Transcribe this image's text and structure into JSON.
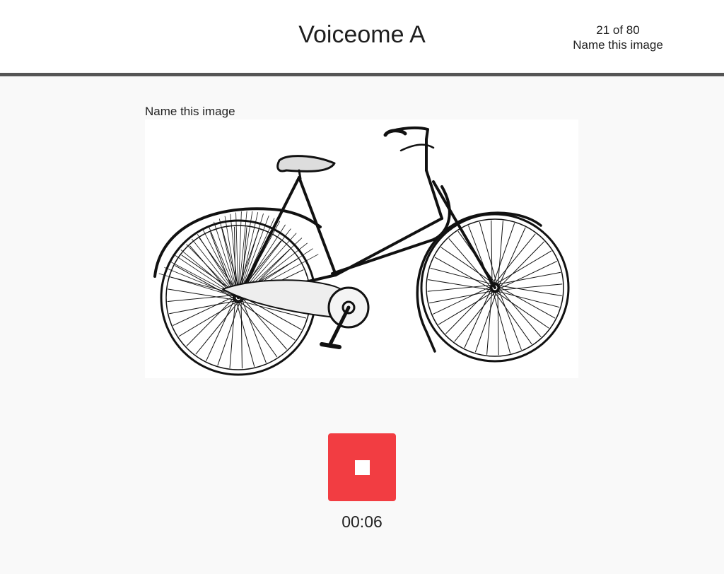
{
  "header": {
    "title": "Voiceome A",
    "progress": "21 of 80",
    "task_name": "Name this image"
  },
  "task": {
    "prompt": "Name this image",
    "image_subject": "bicycle line drawing"
  },
  "recorder": {
    "stop_icon": "stop-icon",
    "timer": "00:06"
  },
  "colors": {
    "header_bg": "#ffffff",
    "header_border": "#555555",
    "page_bg": "#f9f9f9",
    "stop_button": "#f23d42"
  }
}
